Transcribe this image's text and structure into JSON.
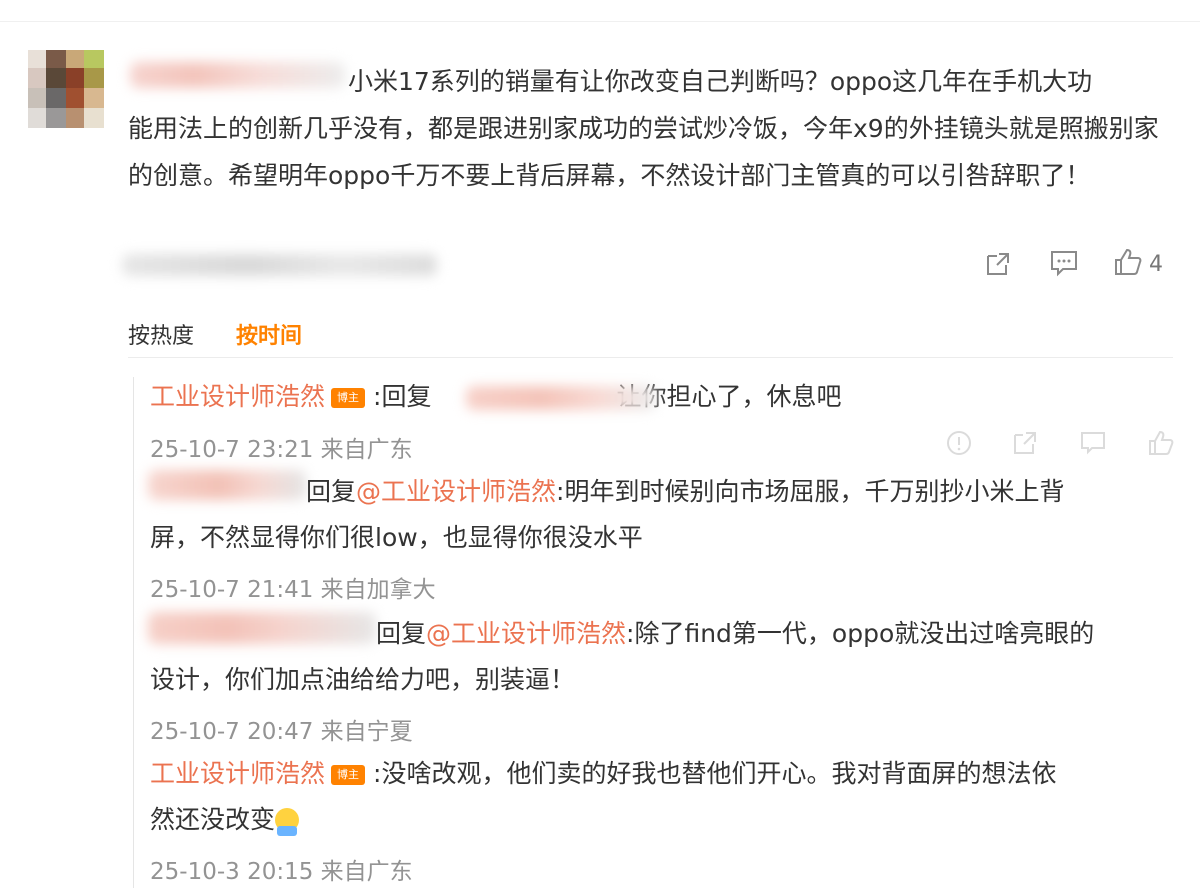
{
  "main_comment": {
    "text_line1": "小米17系列的销量有让你改变自己判断吗？oppo这几年在手机大功",
    "text_rest": "能用法上的创新几乎没有，都是跟进别家成功的尝试炒冷饭，今年x9的外挂镜头就是照搬别家的创意。希望明年oppo千万不要上背后屏幕，不然设计部门主管真的可以引咎辞职了！",
    "like_count": "4",
    "icons": {
      "share": "share-icon",
      "comment": "comment-icon",
      "like": "thumbs-up-icon"
    }
  },
  "sort_tabs": {
    "hot": "按热度",
    "time": "按时间",
    "active": "time"
  },
  "replies": [
    {
      "author": "工业设计师浩然",
      "badge": "博主",
      "prefix": ":回复",
      "text": "让你担心了，休息吧",
      "time": "25-10-7 23:21 来自广东"
    },
    {
      "prefix": "回复",
      "mention": "@工业设计师浩然",
      "text_line1": ":明年到时候别向市场屈服，千万别抄小米上背",
      "text_line2": "屏，不然显得你们很low，也显得你很没水平",
      "time": "25-10-7 21:41 来自加拿大"
    },
    {
      "prefix": "回复",
      "mention": "@工业设计师浩然",
      "text_line1": ":除了find第一代，oppo就没出过啥亮眼的",
      "text_line2": "设计，你们加点油给给力吧，别装逼！",
      "time": "25-10-7 20:47 来自宁夏"
    },
    {
      "author": "工业设计师浩然",
      "badge": "博主",
      "text_line1": ":没啥改观，他们卖的好我也替他们开心。我对背面屏的想法依",
      "text_line2": "然还没改变",
      "emoji": "hug-emoji",
      "time": "25-10-3 20:15 来自广东"
    }
  ],
  "colors": {
    "accent": "#ff8200",
    "author": "#eb7350",
    "muted": "#939393"
  }
}
